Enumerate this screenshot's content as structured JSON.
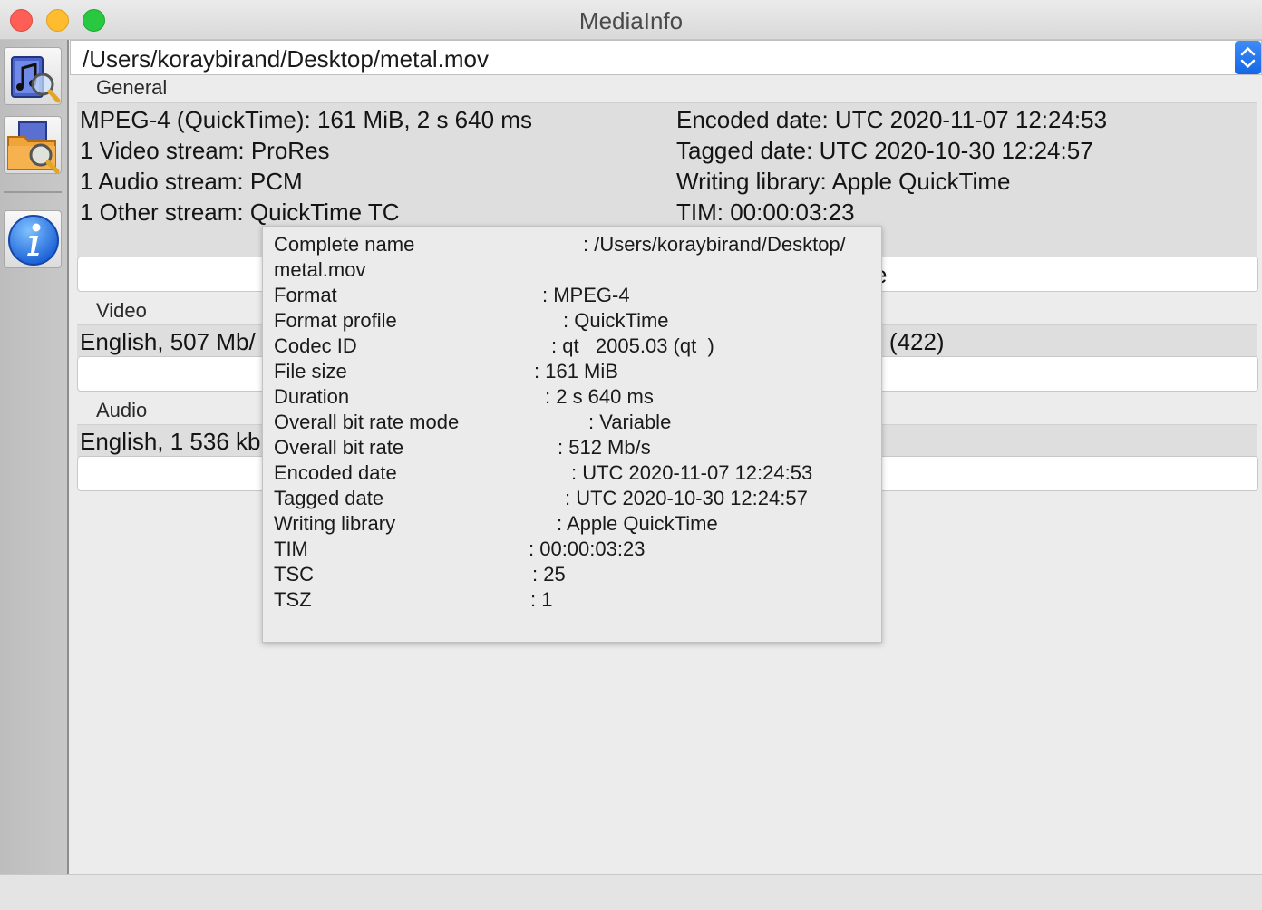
{
  "window": {
    "title": "MediaInfo"
  },
  "sidebar": {
    "items": [
      {
        "icon": "music-magnifier-icon"
      },
      {
        "icon": "folder-magnifier-icon"
      },
      {
        "icon": "info-icon"
      }
    ]
  },
  "file_path": "/Users/koraybirand/Desktop/metal.mov",
  "general": {
    "label": "General",
    "left": [
      "MPEG-4 (QuickTime): 161 MiB, 2 s 640 ms",
      "1 Video stream: ProRes",
      "1 Audio stream: PCM",
      "1 Other stream: QuickTime TC"
    ],
    "right": [
      "Encoded date: UTC 2020-11-07 12:24:53",
      "Tagged date: UTC 2020-10-30 12:24:57",
      "Writing library: Apple QuickTime",
      "TIM: 00:00:03:23"
    ],
    "bar_fragment": "e"
  },
  "video": {
    "label": "Video",
    "left": "English, 507 Mb/",
    "right": ") (422)"
  },
  "audio": {
    "label": "Audio",
    "left": "English, 1 536 kb"
  },
  "tooltip": {
    "rows": [
      {
        "name": "Complete name",
        "value": ": /Users/koraybirand/Desktop/"
      },
      {
        "name": "metal.mov",
        "value": ""
      },
      {
        "name": "Format",
        "value": ": MPEG-4"
      },
      {
        "name": "Format profile",
        "value": ": QuickTime"
      },
      {
        "name": "Codec ID",
        "value": ": qt   2005.03 (qt  )"
      },
      {
        "name": "File size",
        "value": ": 161 MiB"
      },
      {
        "name": "Duration",
        "value": ": 2 s 640 ms"
      },
      {
        "name": "Overall bit rate mode",
        "value": ": Variable"
      },
      {
        "name": "Overall bit rate",
        "value": ": 512 Mb/s"
      },
      {
        "name": "Encoded date",
        "value": ": UTC 2020-11-07 12:24:53"
      },
      {
        "name": "Tagged date",
        "value": ": UTC 2020-10-30 12:24:57"
      },
      {
        "name": "Writing library",
        "value": ": Apple QuickTime"
      },
      {
        "name": "TIM",
        "value": ": 00:00:03:23"
      },
      {
        "name": "TSC",
        "value": ": 25"
      },
      {
        "name": "TSZ",
        "value": ": 1"
      }
    ]
  }
}
